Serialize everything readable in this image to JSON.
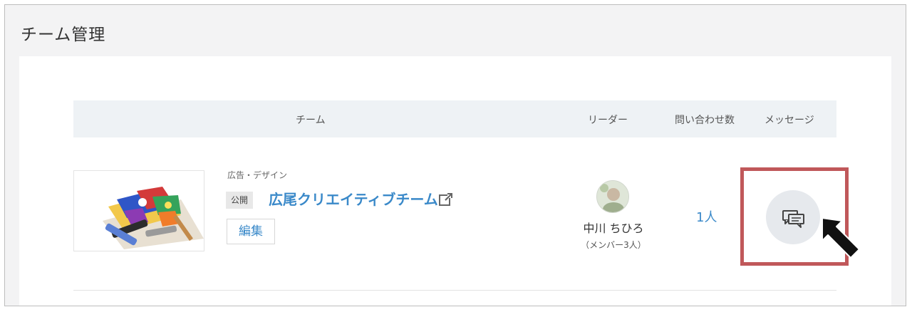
{
  "page": {
    "title": "チーム管理"
  },
  "table": {
    "headers": {
      "team": "チーム",
      "leader": "リーダー",
      "inquiries": "問い合わせ数",
      "message": "メッセージ"
    },
    "rows": [
      {
        "category": "広告・デザイン",
        "status": "公開",
        "team_name": "広尾クリエイティブチーム",
        "edit_label": "編集",
        "leader_name": "中川 ちひろ",
        "leader_members": "（メンバー3人）",
        "inquiry_count": "1人",
        "message_icon": "chat-bubbles-icon"
      }
    ]
  },
  "colors": {
    "link": "#3a89c9",
    "highlight": "#c0585a",
    "header_bg": "#eef2f5"
  }
}
